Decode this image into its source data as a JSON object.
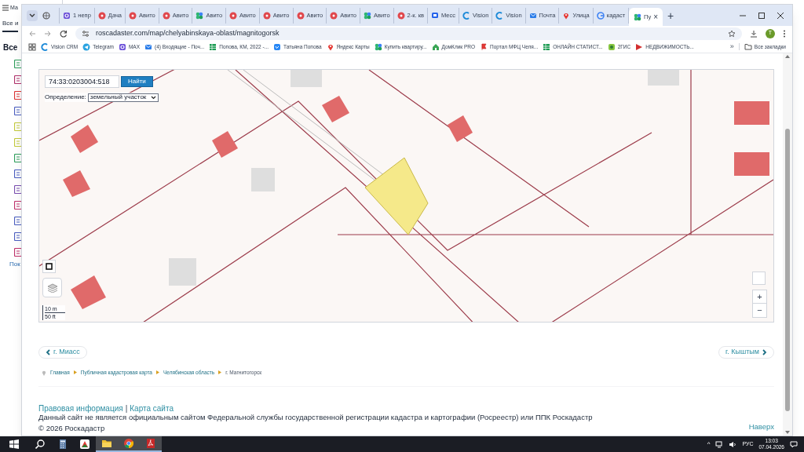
{
  "background_window": {
    "title": "Ма",
    "tab": "Все и",
    "heading": "Все",
    "link": "Пок"
  },
  "browser": {
    "tabs": [
      {
        "kind": "globe",
        "selected": false
      },
      {
        "kind": "ring",
        "title": "1 непр",
        "selected": false
      },
      {
        "kind": "badge",
        "title": "Дача",
        "selected": false
      },
      {
        "kind": "badge",
        "title": "Авито",
        "selected": false
      },
      {
        "kind": "badge",
        "title": "Авито",
        "selected": false
      },
      {
        "kind": "clover",
        "title": "Авито",
        "selected": false
      },
      {
        "kind": "badge",
        "title": "Авито",
        "selected": false
      },
      {
        "kind": "badge",
        "title": "Авито",
        "selected": false
      },
      {
        "kind": "badge",
        "title": "Авито",
        "selected": false
      },
      {
        "kind": "badge",
        "title": "Авито",
        "selected": false
      },
      {
        "kind": "clover",
        "title": "Авито",
        "selected": false
      },
      {
        "kind": "badge",
        "title": "2-к. кв",
        "selected": false
      },
      {
        "kind": "chat",
        "title": "Месс",
        "selected": false
      },
      {
        "kind": "swirl",
        "title": "Vision",
        "selected": false
      },
      {
        "kind": "swirl",
        "title": "Vision",
        "selected": false
      },
      {
        "kind": "mail",
        "title": "Почта",
        "selected": false
      },
      {
        "kind": "pin",
        "title": "Улица",
        "selected": false
      },
      {
        "kind": "letter",
        "title": "кадаст",
        "selected": false
      },
      {
        "kind": "clover",
        "title": "Пу",
        "selected": true,
        "close": "×"
      }
    ],
    "new_tab": "+",
    "address": "roscadaster.com/map/chelyabinskaya-oblast/magnitogorsk",
    "profile": "Т",
    "bookmarks": [
      {
        "kind": "swirl",
        "title": "Vision CRM"
      },
      {
        "kind": "plane",
        "title": "Telegram"
      },
      {
        "kind": "ring",
        "title": "MAX"
      },
      {
        "kind": "mail",
        "title": "(4) Входящие - Поч..."
      },
      {
        "kind": "sheet",
        "title": "Попова, КМ, 2022 -..."
      },
      {
        "kind": "vk",
        "title": "Татьяна Попова"
      },
      {
        "kind": "pin",
        "title": "Яндекс Карты"
      },
      {
        "kind": "clover",
        "title": "Купить квартиру..."
      },
      {
        "kind": "house",
        "title": "ДомКлик PRO"
      },
      {
        "kind": "flag",
        "title": "Портал МФЦ Челя..."
      },
      {
        "kind": "sheet",
        "title": "ОНЛАЙН СТАТИСТ..."
      },
      {
        "kind": "map",
        "title": "2ГИС"
      },
      {
        "kind": "play",
        "title": "НЕДВИЖИМОСТЬ..."
      }
    ],
    "more_bookmarks": "»",
    "all_bookmarks": "Все закладки"
  },
  "map": {
    "search_value": "74:33:0203004:518",
    "search_button": "Найти",
    "definition_label": "Определение:",
    "definition_value": "земельный участок",
    "scale": [
      "10 m",
      "50 ft"
    ],
    "zoom": [
      "+",
      "−"
    ]
  },
  "nav": {
    "prev": "г. Миасс",
    "next": "г. Кыштым"
  },
  "breadcrumbs": [
    "Главная",
    "Публичная кадастровая карта",
    "Челябинская область",
    "г. Магнитогорск"
  ],
  "footer": {
    "links": [
      "Правовая информация",
      "Карта сайта"
    ],
    "separator": "|",
    "disclaimer": "Данный сайт не является официальным сайтом Федеральной службы государственной регистрации кадастра и картографии (Росреестр) или ППК Роскадастр",
    "copyright": "© 2026 Роскадастр",
    "to_top": "Наверх"
  },
  "taskbar": {
    "apps": [
      {
        "kind": "calculator",
        "active": false
      },
      {
        "kind": "mosaic",
        "active": false
      },
      {
        "kind": "folder",
        "active": true
      },
      {
        "kind": "chrome",
        "active": true
      },
      {
        "kind": "pdf",
        "active": true
      }
    ],
    "tray_arrow": "^",
    "language": "РУС",
    "time": "13:03",
    "date": "07.04.2026"
  }
}
